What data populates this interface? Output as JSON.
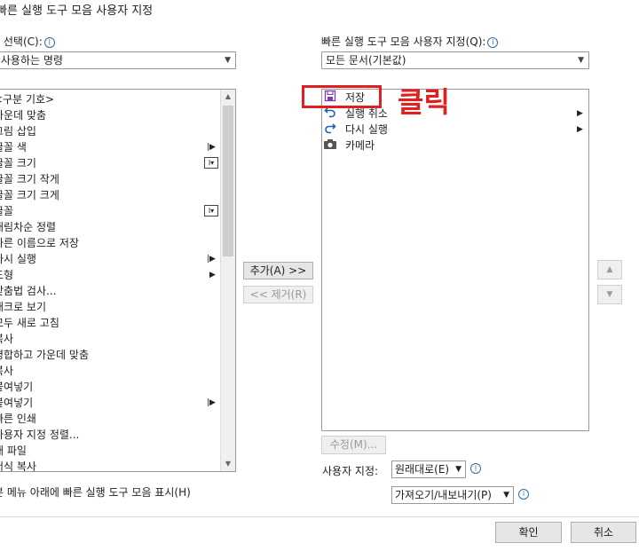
{
  "dialog": {
    "header": "빠른 실행 도구 모음 사용자 지정"
  },
  "left": {
    "choose_label": "명령 선택(C):",
    "choose_value": "자주 사용하는 명령",
    "commands": [
      {
        "label": "<구분 기호>"
      },
      {
        "label": "가운데 맞춤"
      },
      {
        "label": "그림 삽입"
      },
      {
        "label": "글꼴 색",
        "submenu": true
      },
      {
        "label": "글꼴 크기",
        "edit": true
      },
      {
        "label": "글꼴 크기 작게"
      },
      {
        "label": "글꼴 크기 크게"
      },
      {
        "label": "글꼴",
        "edit": true
      },
      {
        "label": "내림차순 정렬"
      },
      {
        "label": "다른 이름으로 저장"
      },
      {
        "label": "다시 실행",
        "submenu": true
      },
      {
        "label": "도형",
        "submenu_plain": true
      },
      {
        "label": "맞춤법 검사..."
      },
      {
        "label": "매크로 보기"
      },
      {
        "label": "모두 새로 고침"
      },
      {
        "label": "복사"
      },
      {
        "label": "병합하고 가운데 맞춤"
      },
      {
        "label": "복사"
      },
      {
        "label": "붙여넣기"
      },
      {
        "label": "붙여넣기",
        "submenu": true
      },
      {
        "label": "빠른 인쇄"
      },
      {
        "label": "사용자 지정 정렬..."
      },
      {
        "label": "새 파일"
      },
      {
        "label": "서식 복사"
      }
    ],
    "show_below_label": "리본 메뉴 아래에 빠른 실행 도구 모음 표시(H)"
  },
  "middle": {
    "add_label": "추가(A) >>",
    "remove_label": "<< 제거(R)"
  },
  "right": {
    "customize_label": "빠른 실행 도구 모음 사용자 지정(Q):",
    "customize_value": "모든 문서(기본값)",
    "items": [
      {
        "label": "저장",
        "icon": "save-icon"
      },
      {
        "label": "실행 취소",
        "icon": "undo-icon",
        "submenu": true
      },
      {
        "label": "다시 실행",
        "icon": "redo-icon",
        "submenu": true
      },
      {
        "label": "카메라",
        "icon": "camera-icon"
      }
    ],
    "modify_label": "수정(M)...",
    "custom_label": "사용자 지정:",
    "reset_label": "원래대로(E)",
    "import_export_label": "가져오기/내보내기(P)"
  },
  "annotation": {
    "text": "클릭",
    "color": "#e02020"
  },
  "footer": {
    "ok_label": "확인",
    "cancel_label": "취소"
  }
}
